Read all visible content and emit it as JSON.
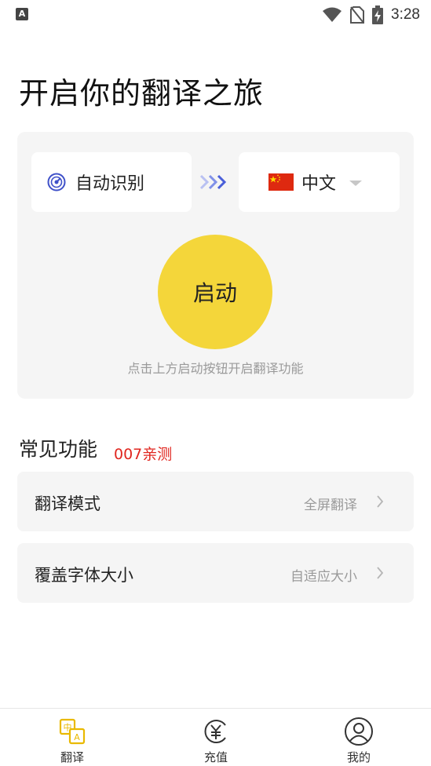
{
  "status_bar": {
    "time": "3:28"
  },
  "page": {
    "title": "开启你的翻译之旅"
  },
  "translator": {
    "source_lang": "自动识别",
    "target_lang": "中文",
    "start_label": "启动",
    "hint": "点击上方启动按钮开启翻译功能"
  },
  "features": {
    "title": "常见功能",
    "badge": "007亲测",
    "items": [
      {
        "label": "翻译模式",
        "value": "全屏翻译"
      },
      {
        "label": "覆盖字体大小",
        "value": "自适应大小"
      }
    ]
  },
  "tabbar": {
    "tabs": [
      {
        "label": "翻译",
        "icon": "translate-icon"
      },
      {
        "label": "充值",
        "icon": "yuan-icon"
      },
      {
        "label": "我的",
        "icon": "profile-icon"
      }
    ]
  },
  "colors": {
    "accent_yellow": "#f4d63a",
    "badge_red": "#e0261f",
    "arrow_blue": "#4a5fd9",
    "card_bg": "#f5f5f5"
  }
}
